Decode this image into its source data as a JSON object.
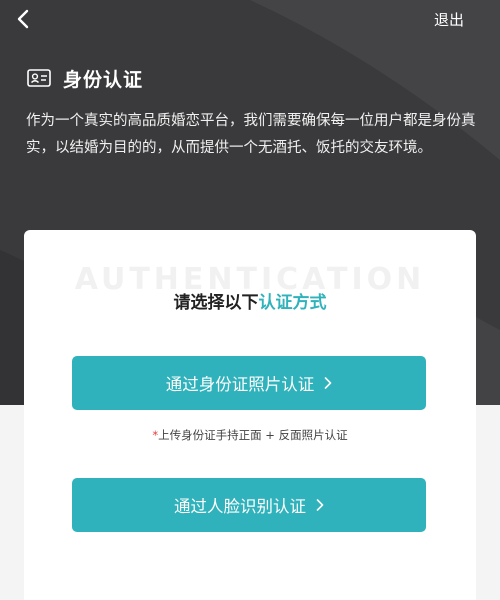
{
  "header": {
    "logout_label": "退出",
    "title": "身份认证",
    "description": "作为一个真实的高品质婚恋平台，我们需要确保每一位用户都是身份真实，以结婚为目的的，从而提供一个无酒托、饭托的交友环境。"
  },
  "card": {
    "watermark": "AUTHENTICATION",
    "heading_prefix": "请选择以下",
    "heading_accent": "认证方式",
    "options": [
      {
        "label": "通过身份证照片认证"
      },
      {
        "label": "通过人脸识别认证"
      }
    ],
    "hint_asterisk": "*",
    "hint": "上传身份证手持正面 + 反面照片认证"
  },
  "colors": {
    "header_background": "#3a3a3c",
    "accent": "#2fb2bb",
    "asterisk": "#e33c3c"
  },
  "icons": [
    "back-arrow-icon",
    "id-card-icon",
    "chevron-right-icon"
  ]
}
